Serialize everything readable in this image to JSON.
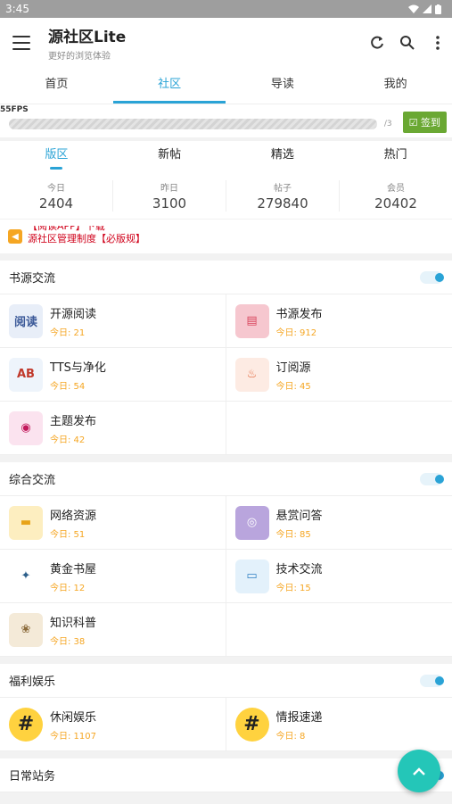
{
  "status": {
    "time": "3:45"
  },
  "appbar": {
    "title": "源社区Lite",
    "subtitle": "更好的浏览体验"
  },
  "top_tabs": [
    "首页",
    "社区",
    "导读",
    "我的"
  ],
  "fps": {
    "label": "55FPS",
    "count": "/3",
    "signin": "签到"
  },
  "sub_tabs": [
    "版区",
    "新帖",
    "精选",
    "热门"
  ],
  "stats": [
    {
      "label": "今日",
      "value": "2404"
    },
    {
      "label": "昨日",
      "value": "3100"
    },
    {
      "label": "帖子",
      "value": "279840"
    },
    {
      "label": "会员",
      "value": "20402"
    }
  ],
  "notice": {
    "line1": "【阅读APP】下载",
    "line2": "源社区管理制度【必版规】"
  },
  "sections": [
    {
      "title": "书源交流",
      "items": [
        {
          "name": "开源阅读",
          "today": "今日: 21",
          "icon": "book-reader-icon",
          "bg": "#e8eef8",
          "fg": "#3b5998",
          "glyph": "阅读"
        },
        {
          "name": "书源发布",
          "today": "今日: 912",
          "icon": "document-pink-icon",
          "bg": "#f6c7cf",
          "fg": "#d9485f",
          "glyph": "▤"
        },
        {
          "name": "TTS与净化",
          "today": "今日: 54",
          "icon": "abc-letters-icon",
          "bg": "#eef4fb",
          "fg": "#c0392b",
          "glyph": "AB"
        },
        {
          "name": "订阅源",
          "today": "今日: 45",
          "icon": "rss-flame-icon",
          "bg": "#fdebe3",
          "fg": "#e2673c",
          "glyph": "♨"
        },
        {
          "name": "主题发布",
          "today": "今日: 42",
          "icon": "paint-palette-icon",
          "bg": "#fbe3ef",
          "fg": "#c2185b",
          "glyph": "◉"
        }
      ]
    },
    {
      "title": "综合交流",
      "items": [
        {
          "name": "网络资源",
          "today": "今日: 51",
          "icon": "folder-icon",
          "bg": "#fdeec0",
          "fg": "#e8a317",
          "glyph": "▬"
        },
        {
          "name": "悬赏问答",
          "today": "今日: 85",
          "icon": "game-controller-icon",
          "bg": "#b9a5dd",
          "fg": "#ffffff",
          "glyph": "◎"
        },
        {
          "name": "黄金书屋",
          "today": "今日: 12",
          "icon": "open-book-icon",
          "bg": "#ffffff",
          "fg": "#2c5f8a",
          "glyph": "✦"
        },
        {
          "name": "技术交流",
          "today": "今日: 15",
          "icon": "laptop-icon",
          "bg": "#e3f1fb",
          "fg": "#2f80c2",
          "glyph": "▭"
        },
        {
          "name": "知识科普",
          "today": "今日: 38",
          "icon": "knowledge-book-icon",
          "bg": "#f4ead8",
          "fg": "#8a6a3a",
          "glyph": "❀"
        }
      ]
    },
    {
      "title": "福利娱乐",
      "items": [
        {
          "name": "休闲娱乐",
          "today": "今日: 1107",
          "icon": "hashtag-icon",
          "bg": "#ffd23f",
          "fg": "#222222",
          "glyph": "#"
        },
        {
          "name": "情报速递",
          "today": "今日: 8",
          "icon": "hashtag-icon",
          "bg": "#ffd23f",
          "fg": "#222222",
          "glyph": "#"
        }
      ]
    },
    {
      "title": "日常站务",
      "items": []
    }
  ],
  "colors": {
    "accent": "#2aa3d6",
    "today": "#f5a623",
    "fab": "#24c6b8"
  }
}
